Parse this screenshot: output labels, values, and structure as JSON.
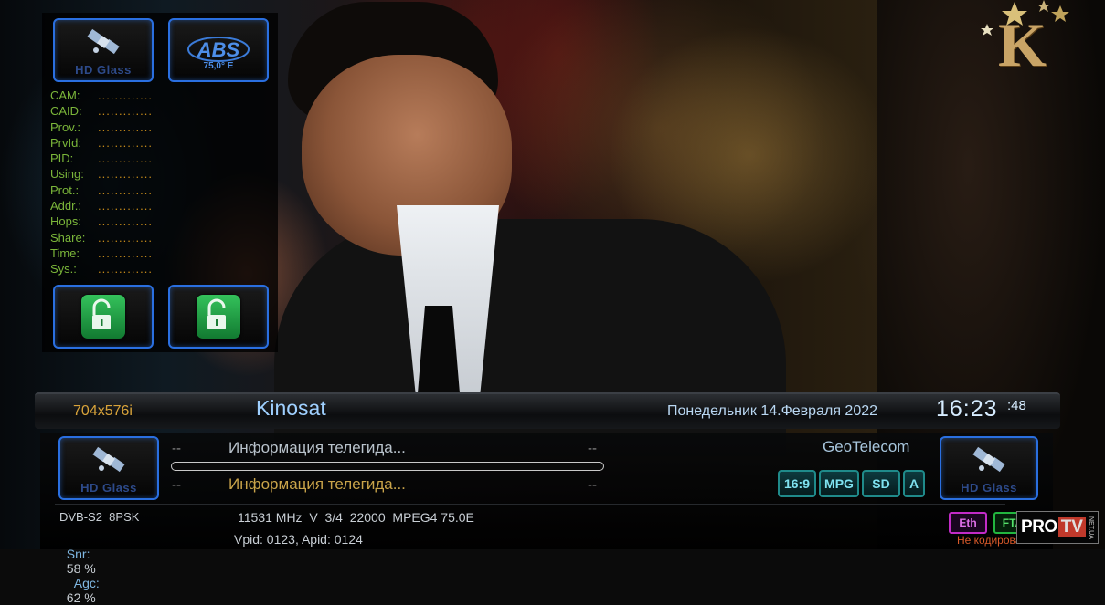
{
  "softcam_panel": {
    "top_left_button": {
      "icon": "satellite-icon",
      "label": "HD Glass"
    },
    "top_right_button": {
      "icon": "abs-satellite-logo",
      "logo_text": "ABS",
      "position_text": "75,0° E"
    },
    "fields": [
      {
        "key": "CAM:",
        "value": "............."
      },
      {
        "key": "CAID:",
        "value": "............."
      },
      {
        "key": "Prov.:",
        "value": "............."
      },
      {
        "key": "PrvId:",
        "value": "............."
      },
      {
        "key": "PID:",
        "value": "............."
      },
      {
        "key": "Using:",
        "value": "............."
      },
      {
        "key": "Prot.:",
        "value": "............."
      },
      {
        "key": "Addr.:",
        "value": "............."
      },
      {
        "key": "Hops:",
        "value": "............."
      },
      {
        "key": "Share:",
        "value": "............."
      },
      {
        "key": "Time:",
        "value": "............."
      },
      {
        "key": "Sys.:",
        "value": "............."
      }
    ],
    "lock_buttons": [
      "unlock-icon",
      "unlock-icon"
    ]
  },
  "logo": {
    "letter": "K"
  },
  "infobar": {
    "resolution": "704x576i",
    "channel": "Kinosat",
    "date": "Понедельник  14.Февраля 2022",
    "time": "16:23",
    "seconds": ":48",
    "left_button_label": "HD Glass",
    "right_button_label": "HD Glass",
    "epg": {
      "now_time": "--",
      "now_title": "Информация телегида...",
      "now_end": "--",
      "next_time": "--",
      "next_title": "Информация телегида...",
      "next_end": "--",
      "progress": 0
    },
    "provider": "GeoTelecom",
    "badges": [
      "16:9",
      "MPG",
      "SD",
      "A"
    ],
    "tuner": {
      "system": "DVB-S2  8PSK",
      "frequency_line": "11531 MHz  V  3/4  22000  MPEG4 75.0E",
      "snr_label": "Snr:",
      "snr_value": "58 %",
      "agc_label": "Agc:",
      "agc_value": "62 %",
      "pids": "Vpid: 0123, Apid: 0124"
    },
    "eth_badge": "Eth",
    "fta_badge": "FTA",
    "encryption_status": "Не кодирован"
  },
  "watermark": {
    "pro": "PRO",
    "tv": "TV",
    "net": "NET.UA"
  },
  "colors": {
    "frame_blue": "#2a6fe0",
    "field_green": "#7bb63a",
    "value_orange": "#c58a1a",
    "clock": "#d6ecff"
  }
}
